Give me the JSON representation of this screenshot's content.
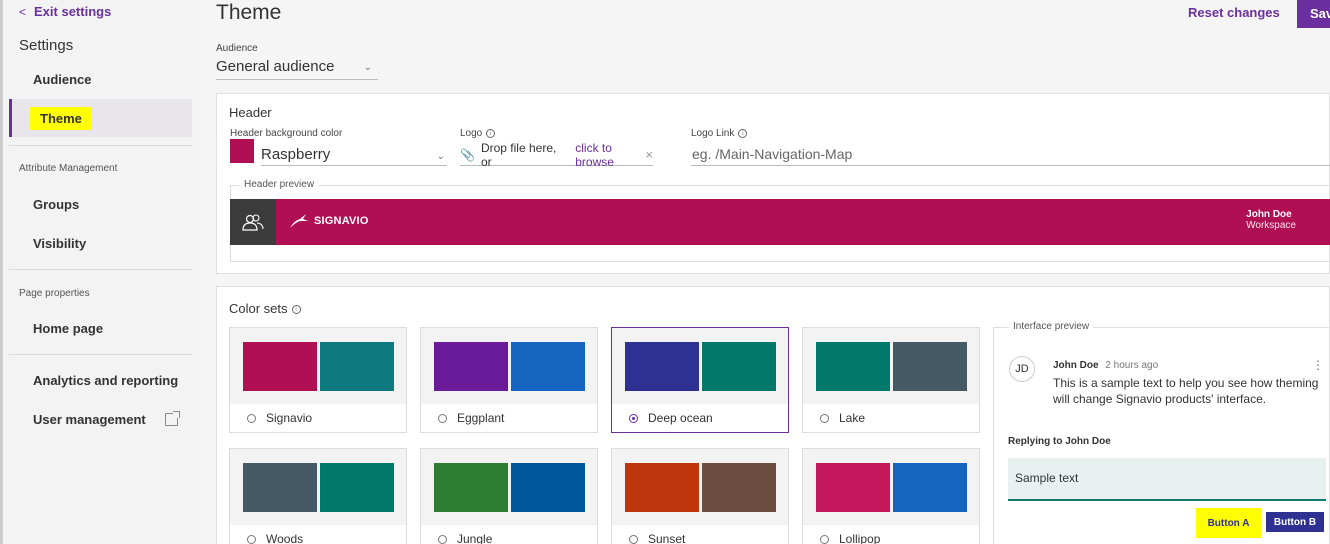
{
  "sidebar": {
    "exit_label": "Exit settings",
    "heading": "Settings",
    "audience": "Audience",
    "theme": "Theme",
    "attr_mgmt": "Attribute Management",
    "groups": "Groups",
    "visibility": "Visibility",
    "page_props": "Page properties",
    "home_page": "Home page",
    "analytics": "Analytics and reporting",
    "user_mgmt": "User management"
  },
  "header": {
    "title": "Theme",
    "reset_label": "Reset changes",
    "save_label": "Save"
  },
  "audience": {
    "label": "Audience",
    "value": "General audience"
  },
  "header_section": {
    "title": "Header",
    "bg_label": "Header background color",
    "bg_value": "Raspberry",
    "bg_color": "#b00f53",
    "logo_label": "Logo",
    "logo_drop": "Drop file here, or",
    "logo_browse": "click to browse",
    "logo_link_label": "Logo Link",
    "logo_link_placeholder": "eg. /Main-Navigation-Map",
    "preview_legend": "Header preview",
    "preview_brand": "SIGNAVIO",
    "preview_user": "John Doe",
    "preview_workspace": "Workspace"
  },
  "color_sets": {
    "title": "Color sets",
    "items": [
      {
        "name": "Signavio",
        "c1": "#b00f53",
        "c2": "#0e7a80",
        "selected": false
      },
      {
        "name": "Eggplant",
        "c1": "#6a1b9a",
        "c2": "#1565c0",
        "selected": false
      },
      {
        "name": "Deep ocean",
        "c1": "#2e3192",
        "c2": "#00796b",
        "selected": true
      },
      {
        "name": "Lake",
        "c1": "#00796b",
        "c2": "#455a64",
        "selected": false
      },
      {
        "name": "Woods",
        "c1": "#455a64",
        "c2": "#00796b",
        "selected": false
      },
      {
        "name": "Jungle",
        "c1": "#2e7d32",
        "c2": "#01579b",
        "selected": false
      },
      {
        "name": "Sunset",
        "c1": "#bf360c",
        "c2": "#6d4c41",
        "selected": false
      },
      {
        "name": "Lollipop",
        "c1": "#c2185b",
        "c2": "#1565c0",
        "selected": false
      }
    ]
  },
  "interface_preview": {
    "legend": "Interface preview",
    "avatar": "JD",
    "name": "John Doe",
    "time": "2 hours ago",
    "text": "This is a sample text to help you see how theming will change Signavio products' interface.",
    "reply_label": "Replying to John Doe",
    "reply_value": "Sample text",
    "button_a": "Button A",
    "button_b": "Button B"
  }
}
